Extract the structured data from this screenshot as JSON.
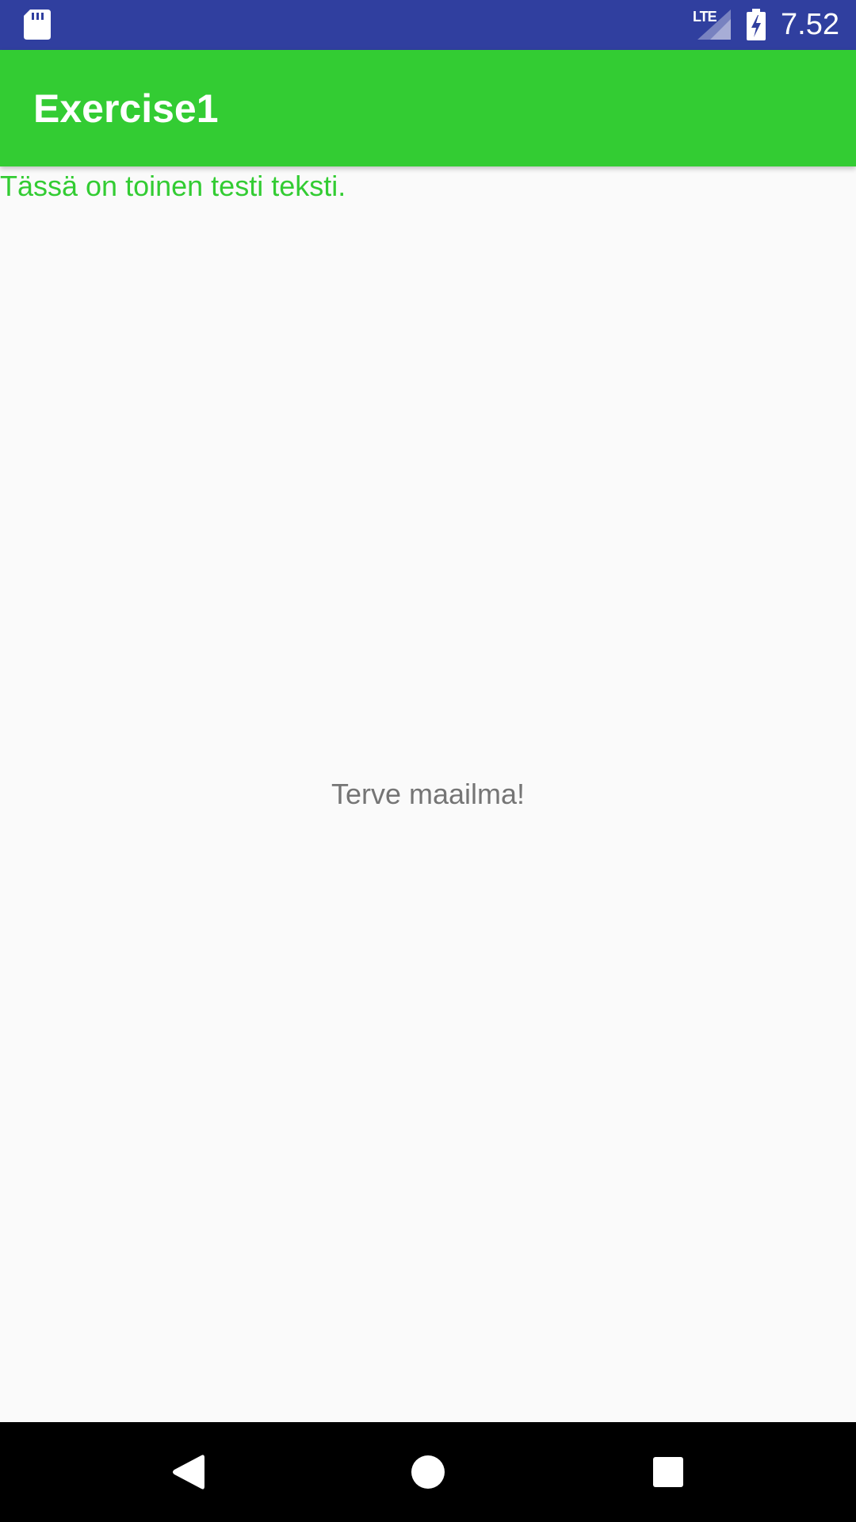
{
  "status_bar": {
    "network_label": "LTE",
    "time": "7.52",
    "icons": [
      "sd-card-icon",
      "signal-icon",
      "battery-charging-icon"
    ],
    "background_color": "#303f9f"
  },
  "app_bar": {
    "title": "Exercise1",
    "background_color": "#33cc33"
  },
  "content": {
    "secondary_text": "Tässä on toinen testi teksti.",
    "secondary_text_color": "#33cc33",
    "center_text": "Terve maailma!",
    "center_text_color": "#757575"
  },
  "nav_bar": {
    "buttons": [
      "back-icon",
      "home-icon",
      "recents-icon"
    ]
  }
}
